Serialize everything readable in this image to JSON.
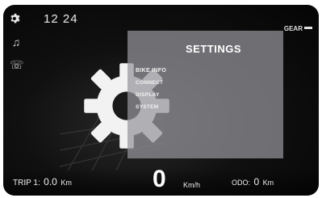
{
  "status": {
    "time": "12 24",
    "gear_label": "GEAR"
  },
  "icons": {
    "settings": "gear-icon",
    "music": "music-icon",
    "phone": "phone-icon"
  },
  "settings": {
    "title": "SETTINGS",
    "items": [
      {
        "label": "BIKE INFO",
        "selected": true
      },
      {
        "label": "CONNECT",
        "selected": false
      },
      {
        "label": "DISPLAY",
        "selected": false
      },
      {
        "label": "SYSTEM",
        "selected": false
      }
    ]
  },
  "trip": {
    "label": "TRIP 1:",
    "value": "0.0",
    "unit": "Km"
  },
  "speed": {
    "value": "0",
    "unit": "Km/h"
  },
  "odo": {
    "label": "ODO:",
    "value": "0",
    "unit": "Km"
  },
  "colors": {
    "panel": "#96969b",
    "text": "#ffffff",
    "screen_bg": "#0b0b0b"
  }
}
